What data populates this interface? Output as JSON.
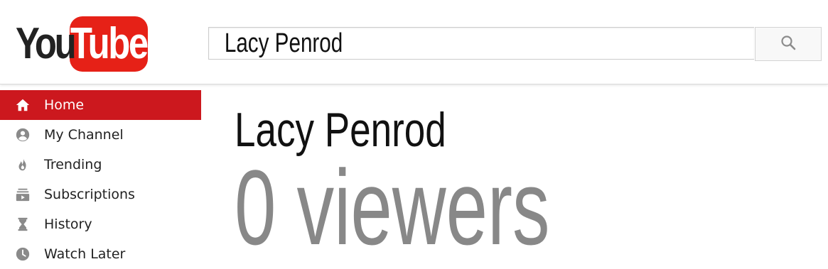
{
  "logo": {
    "you": "You",
    "tube": "Tube"
  },
  "search": {
    "value": "Lacy Penrod",
    "button_icon": "search-icon"
  },
  "sidebar": {
    "items": [
      {
        "label": "Home",
        "icon": "home-icon",
        "active": true
      },
      {
        "label": "My Channel",
        "icon": "account-icon",
        "active": false
      },
      {
        "label": "Trending",
        "icon": "flame-icon",
        "active": false
      },
      {
        "label": "Subscriptions",
        "icon": "subscriptions-icon",
        "active": false
      },
      {
        "label": "History",
        "icon": "hourglass-icon",
        "active": false
      },
      {
        "label": "Watch Later",
        "icon": "clock-icon",
        "active": false
      }
    ]
  },
  "main": {
    "channel_name": "Lacy Penrod",
    "viewers": "0 viewers"
  },
  "colors": {
    "brand_red": "#e62117",
    "active_nav": "#cc181e",
    "viewer_text": "#888888"
  }
}
